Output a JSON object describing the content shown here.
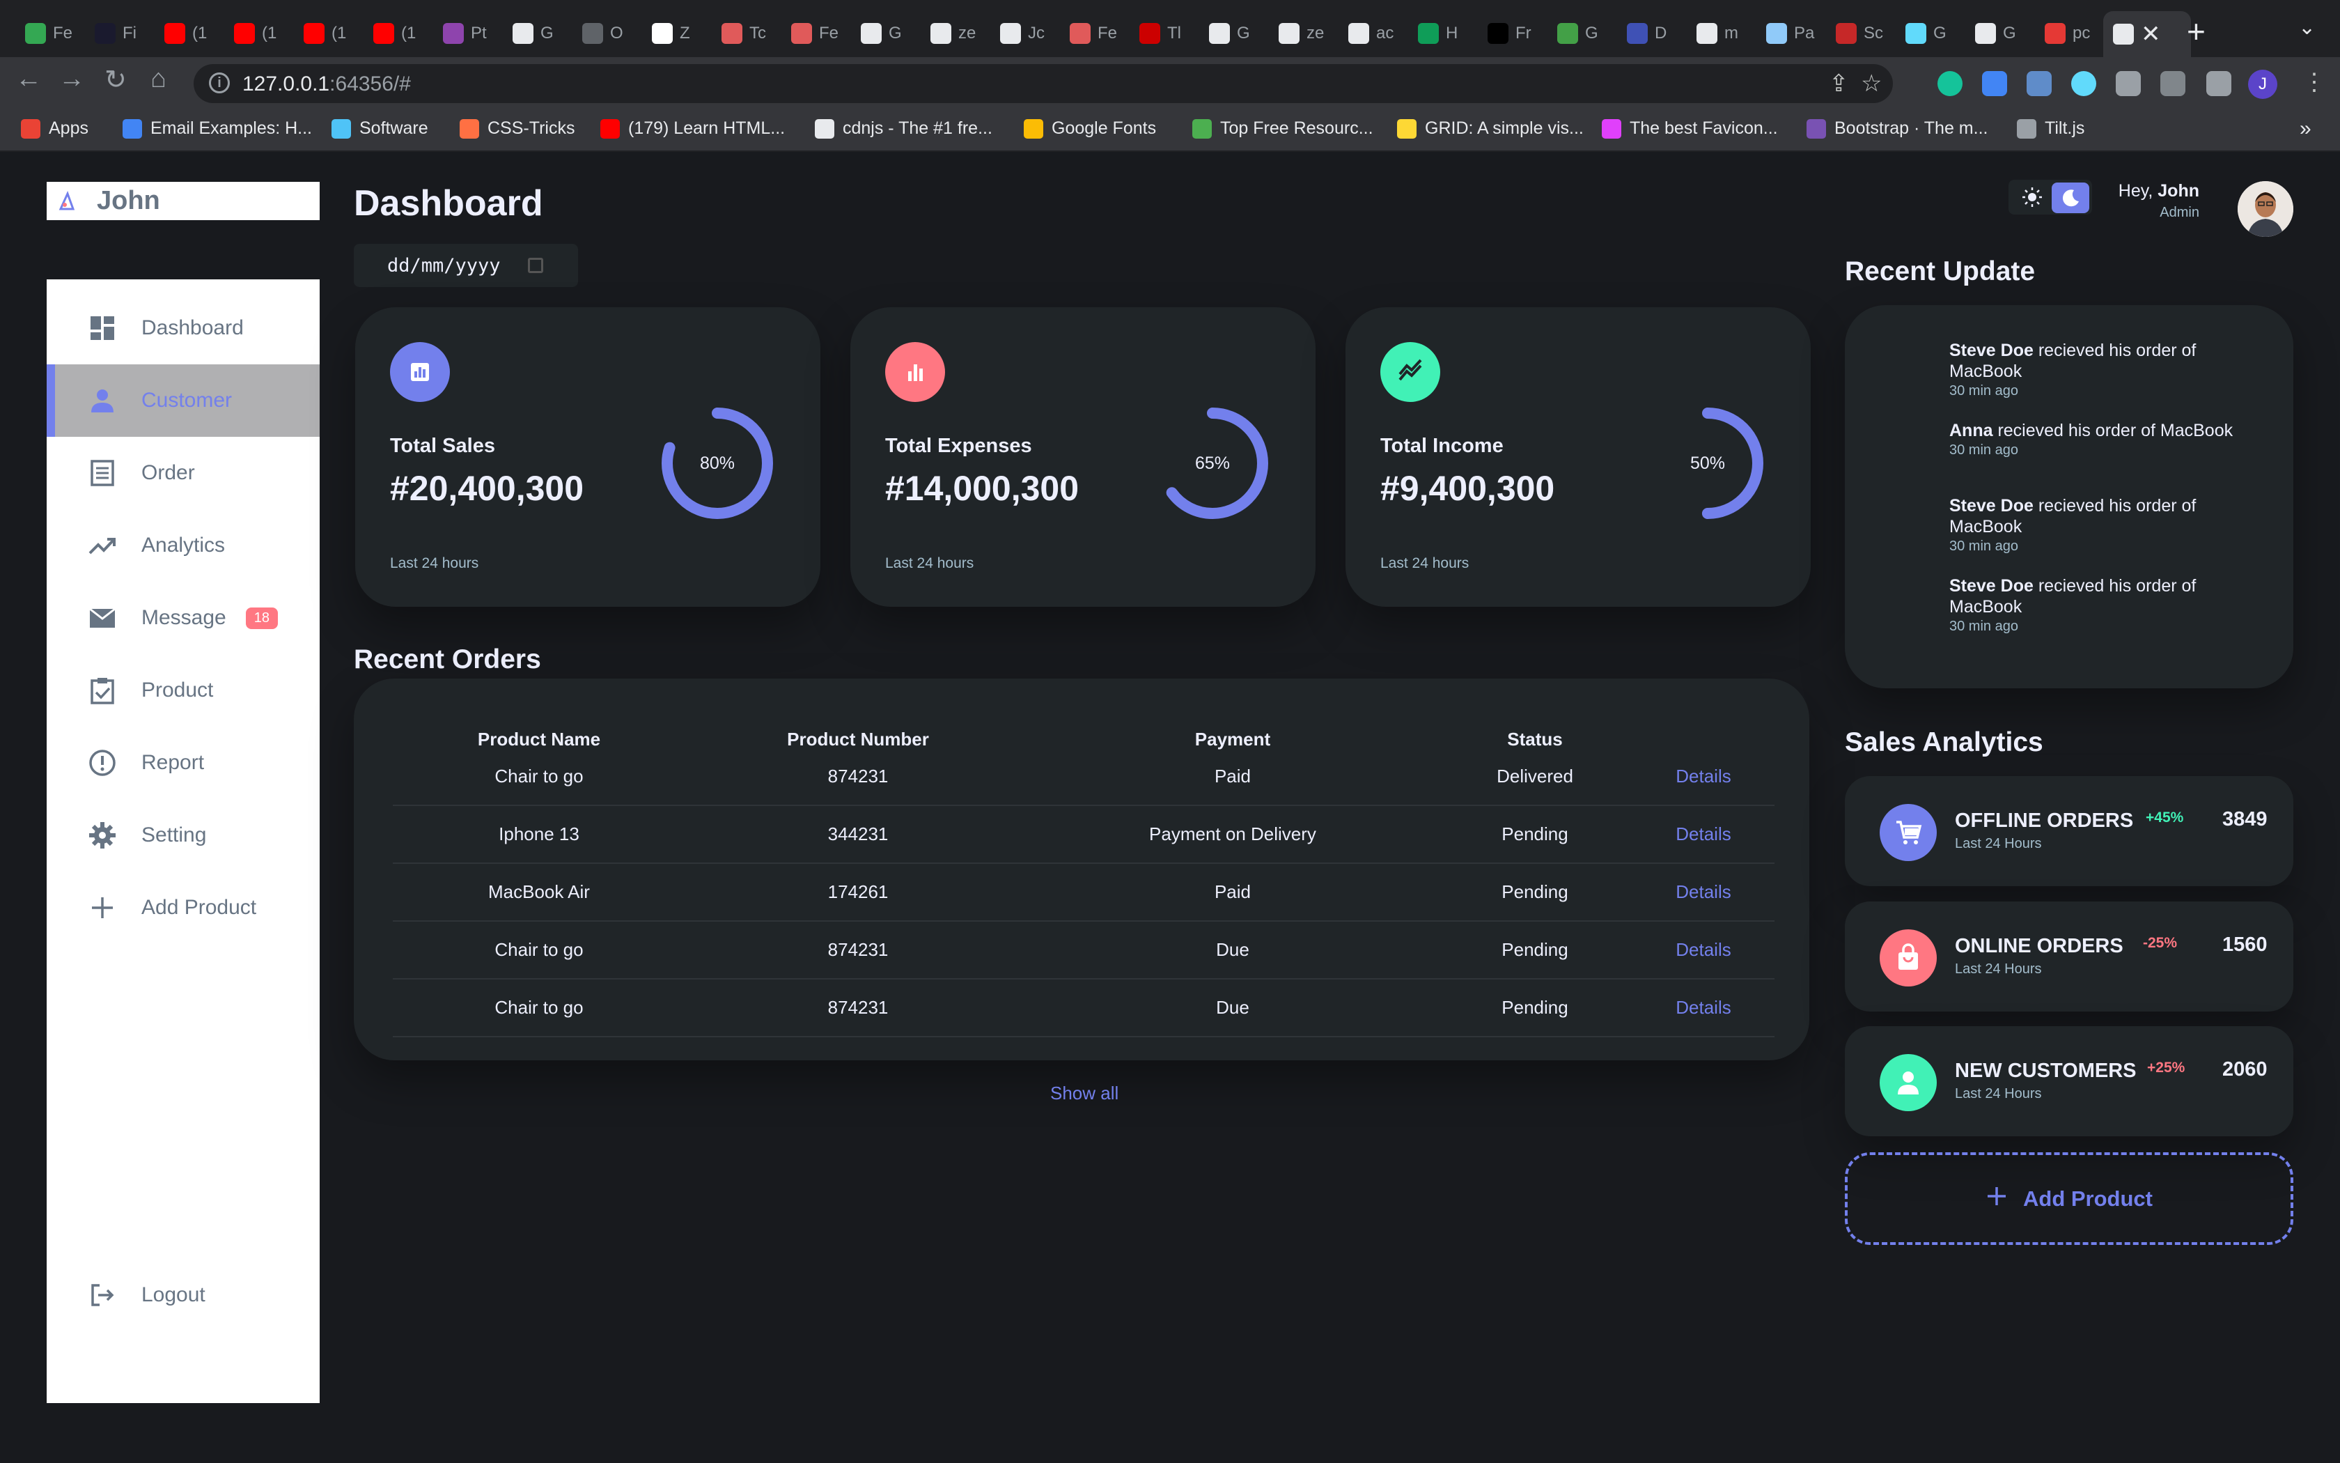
{
  "browser": {
    "tabs": [
      {
        "label": "Fe",
        "color": "#34a853"
      },
      {
        "label": "Fi",
        "color": "#1a1a2e"
      },
      {
        "label": "(1",
        "color": "#ff0000"
      },
      {
        "label": "(1",
        "color": "#ff0000"
      },
      {
        "label": "(1",
        "color": "#ff0000"
      },
      {
        "label": "(1",
        "color": "#ff0000"
      },
      {
        "label": "Pt",
        "color": "#8e44ad"
      },
      {
        "label": "G",
        "color": "#e8eaed"
      },
      {
        "label": "O",
        "color": "#5f6368"
      },
      {
        "label": "Z",
        "color": "#ffffff"
      },
      {
        "label": "Tc",
        "color": "#e05a5a"
      },
      {
        "label": "Fe",
        "color": "#e05a5a"
      },
      {
        "label": "G",
        "color": "#e8eaed"
      },
      {
        "label": "ze",
        "color": "#e8eaed"
      },
      {
        "label": "Jc",
        "color": "#e8eaed"
      },
      {
        "label": "Fe",
        "color": "#e05a5a"
      },
      {
        "label": "Tl",
        "color": "#cc0000"
      },
      {
        "label": "G",
        "color": "#e8eaed"
      },
      {
        "label": "ze",
        "color": "#e8eaed"
      },
      {
        "label": "ac",
        "color": "#e8eaed"
      },
      {
        "label": "H",
        "color": "#0f9d58"
      },
      {
        "label": "Fr",
        "color": "#000000"
      },
      {
        "label": "G",
        "color": "#43a047"
      },
      {
        "label": "D",
        "color": "#3f51b5"
      },
      {
        "label": "m",
        "color": "#e8eaed"
      },
      {
        "label": "Pa",
        "color": "#90caf9"
      },
      {
        "label": "Sc",
        "color": "#c62828"
      },
      {
        "label": "G",
        "color": "#61dafb"
      },
      {
        "label": "G",
        "color": "#e8eaed"
      },
      {
        "label": "pc",
        "color": "#e53935"
      }
    ],
    "url_host": "127.0.0.1",
    "url_rest": ":64356/#",
    "bookmarks": [
      {
        "label": "Apps",
        "color": "#ea4335"
      },
      {
        "label": "Email Examples: H...",
        "color": "#4285f4"
      },
      {
        "label": "Software",
        "color": "#4fc3f7"
      },
      {
        "label": "CSS-Tricks",
        "color": "#ff7043"
      },
      {
        "label": "(179) Learn HTML...",
        "color": "#ff0000"
      },
      {
        "label": "cdnjs - The #1 fre...",
        "color": "#e8eaed"
      },
      {
        "label": "Google Fonts",
        "color": "#fbbc05"
      },
      {
        "label": "Top Free Resourc...",
        "color": "#4caf50"
      },
      {
        "label": "GRID: A simple vis...",
        "color": "#fdd835"
      },
      {
        "label": "The best Favicon...",
        "color": "#e040fb"
      },
      {
        "label": "Bootstrap · The m...",
        "color": "#7952b3"
      },
      {
        "label": "Tilt.js",
        "color": "#9aa0a6"
      }
    ]
  },
  "logo": {
    "name": "John"
  },
  "sidebar": {
    "items": [
      {
        "label": "Dashboard",
        "icon": "grid-icon"
      },
      {
        "label": "Customer",
        "icon": "person-icon"
      },
      {
        "label": "Order",
        "icon": "receipt-icon"
      },
      {
        "label": "Analytics",
        "icon": "trending-up-icon"
      },
      {
        "label": "Message",
        "icon": "mail-icon",
        "badge": "18"
      },
      {
        "label": "Product",
        "icon": "clipboard-icon"
      },
      {
        "label": "Report",
        "icon": "alert-icon"
      },
      {
        "label": "Setting",
        "icon": "gear-icon"
      },
      {
        "label": "Add Product",
        "icon": "plus-icon"
      }
    ],
    "logout": "Logout"
  },
  "main": {
    "title": "Dashboard",
    "date_placeholder": "dd/mm/yyyy",
    "cards": [
      {
        "label": "Total Sales",
        "value": "#20,400,300",
        "percent": "80%",
        "fraction": 0.8,
        "sub": "Last 24 hours",
        "color": "#7380ec",
        "icon": "bar-chart-icon"
      },
      {
        "label": "Total Expenses",
        "value": "#14,000,300",
        "percent": "65%",
        "fraction": 0.65,
        "sub": "Last 24 hours",
        "color": "#ff7782",
        "icon": "bar-chart-icon"
      },
      {
        "label": "Total Income",
        "value": "#9,400,300",
        "percent": "50%",
        "fraction": 0.5,
        "sub": "Last 24 hours",
        "color": "#41f1b6",
        "icon": "trending-icon"
      }
    ],
    "orders_title": "Recent Orders",
    "orders_headers": [
      "Product Name",
      "Product Number",
      "Payment",
      "Status"
    ],
    "orders": [
      {
        "name": "Chair to go",
        "number": "874231",
        "payment": "Paid",
        "status": "Delivered",
        "link": "Details"
      },
      {
        "name": "Iphone 13",
        "number": "344231",
        "payment": "Payment on Delivery",
        "status": "Pending",
        "link": "Details"
      },
      {
        "name": "MacBook Air",
        "number": "174261",
        "payment": "Paid",
        "status": "Pending",
        "link": "Details"
      },
      {
        "name": "Chair to go",
        "number": "874231",
        "payment": "Due",
        "status": "Pending",
        "link": "Details"
      },
      {
        "name": "Chair to go",
        "number": "874231",
        "payment": "Due",
        "status": "Pending",
        "link": "Details"
      }
    ],
    "show_all": "Show all"
  },
  "right": {
    "greeting": "Hey,",
    "user_name": "John",
    "role": "Admin",
    "updates_title": "Recent Update",
    "updates": [
      {
        "name": "Steve Doe",
        "text": " recieved his order of MacBook",
        "time": "30 min ago"
      },
      {
        "name": "Anna",
        "text": " recieved his order of MacBook",
        "time": "30 min ago"
      },
      {
        "name": "Steve Doe",
        "text": " recieved his order of MacBook",
        "time": "30 min ago"
      },
      {
        "name": "Steve Doe",
        "text": " recieved his order of MacBook",
        "time": "30 min ago"
      }
    ],
    "analytics_title": "Sales Analytics",
    "analytics": [
      {
        "title": "OFFLINE ORDERS",
        "sub": "Last 24 Hours",
        "pct": "+45%",
        "pct_color": "#41f1b6",
        "num": "3849",
        "color": "#7380ec",
        "icon": "cart-icon"
      },
      {
        "title": "ONLINE ORDERS",
        "sub": "Last 24 Hours",
        "pct": "-25%",
        "pct_color": "#ff7782",
        "num": "1560",
        "color": "#ff7782",
        "icon": "shopping-bag-icon"
      },
      {
        "title": "NEW CUSTOMERS",
        "sub": "Last 24 Hours",
        "pct": "+25%",
        "pct_color": "#ff7782",
        "num": "2060",
        "color": "#41f1b6",
        "icon": "person-icon"
      }
    ],
    "add_product": "Add Product"
  }
}
